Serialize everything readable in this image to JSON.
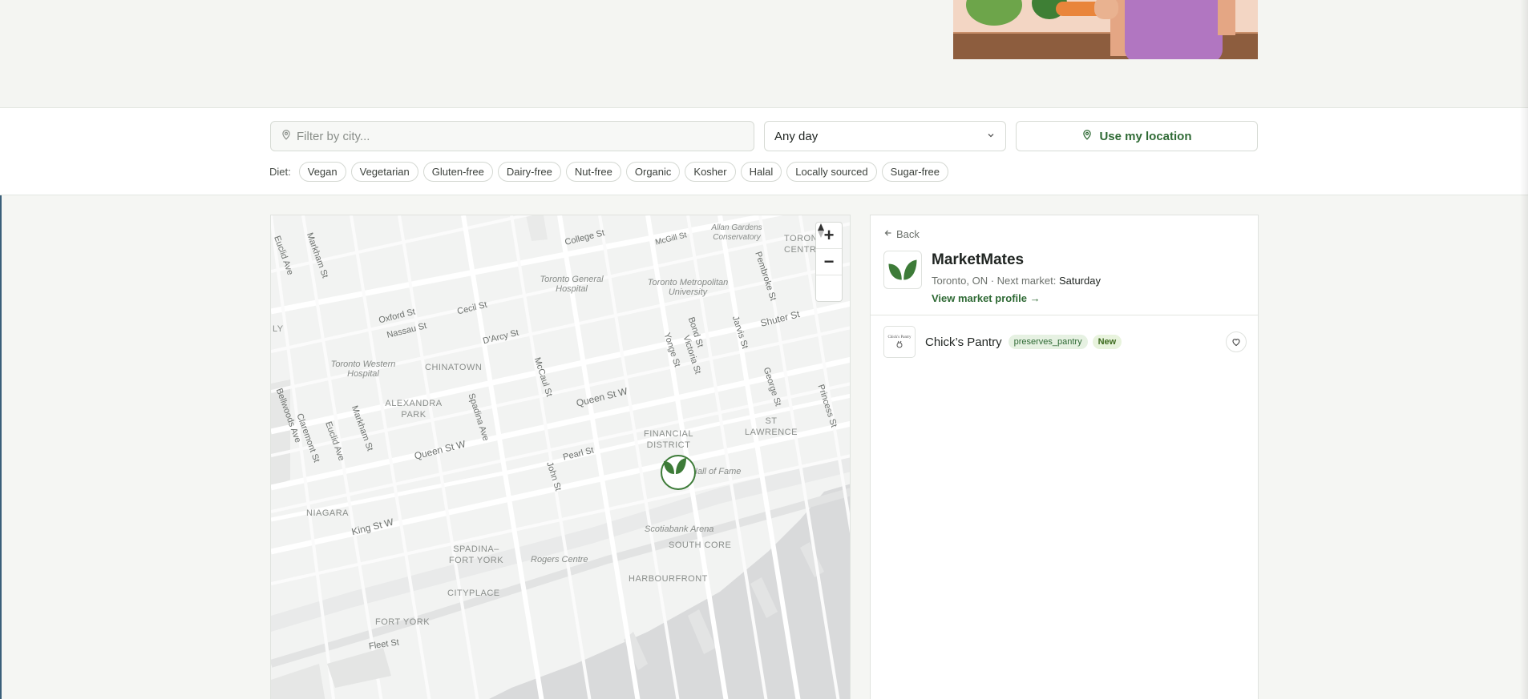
{
  "filters": {
    "city_placeholder": "Filter by city...",
    "day_selected": "Any day",
    "location_button": "Use my location",
    "diet_label": "Diet:",
    "diet_chips": [
      "Vegan",
      "Vegetarian",
      "Gluten-free",
      "Dairy-free",
      "Nut-free",
      "Organic",
      "Kosher",
      "Halal",
      "Locally sourced",
      "Sugar-free"
    ]
  },
  "map": {
    "controls": {
      "zoom_in": "+",
      "zoom_out": "−"
    },
    "labels": {
      "college": "College St",
      "mcgill": "McGill St",
      "allan": "Allan Gardens Conservatory",
      "toronto_centre": "TORONTO CENTRE",
      "markham_top": "Markham St",
      "euclid_top": "Euclid Ave",
      "gen_hospital": "Toronto General Hospital",
      "tmu": "Toronto Metropolitan University",
      "pembroke": "Pembroke St",
      "oxford": "Oxford St",
      "cecil": "Cecil St",
      "nassau": "Nassau St",
      "darcy": "D'Arcy St",
      "bond": "Bond St",
      "jarvis": "Jarvis St",
      "shuter": "Shuter St",
      "yonge": "Yonge St",
      "victoria": "Victoria St",
      "western_hospital": "Toronto Western Hospital",
      "chinatown": "CHINATOWN",
      "mccaul": "McCaul St",
      "queen_w_1": "Queen St W",
      "george": "George St",
      "princess": "Princess St",
      "alexandra": "ALEXANDRA PARK",
      "spadina": "Spadina Ave",
      "financial": "FINANCIAL DISTRICT",
      "st_lawrence": "ST LAWRENCE",
      "bellwoods": "Bellwoods Ave",
      "claremont": "Claremont St",
      "euclid": "Euclid Ave",
      "markham": "Markham St",
      "queen_w_2": "Queen St W",
      "pearl": "Pearl St",
      "john": "John St",
      "hall_of_fame": "Hall of Fame",
      "niagara": "NIAGARA",
      "king": "King St W",
      "scotiabank": "Scotiabank Arena",
      "south_core": "SOUTH CORE",
      "spadina_fort": "SPADINA– FORT YORK",
      "rogers": "Rogers Centre",
      "harbourfront": "HARBOURFRONT",
      "cityplace": "CITYPLACE",
      "fort_york": "FORT YORK",
      "fleet": "Fleet St",
      "ly": "LY"
    }
  },
  "panel": {
    "back": "Back",
    "market_name": "MarketMates",
    "location": "Toronto, ON · Next market: ",
    "next_day": "Saturday",
    "profile_link": "View market profile →",
    "vendor": {
      "name": "Chick’s Pantry",
      "category_tag": "preserves_pantry",
      "new_tag": "New",
      "thumb_text": "Chick's Pantry"
    }
  },
  "colors": {
    "accent": "#2f6a35",
    "leaf": "#3d7b38"
  }
}
